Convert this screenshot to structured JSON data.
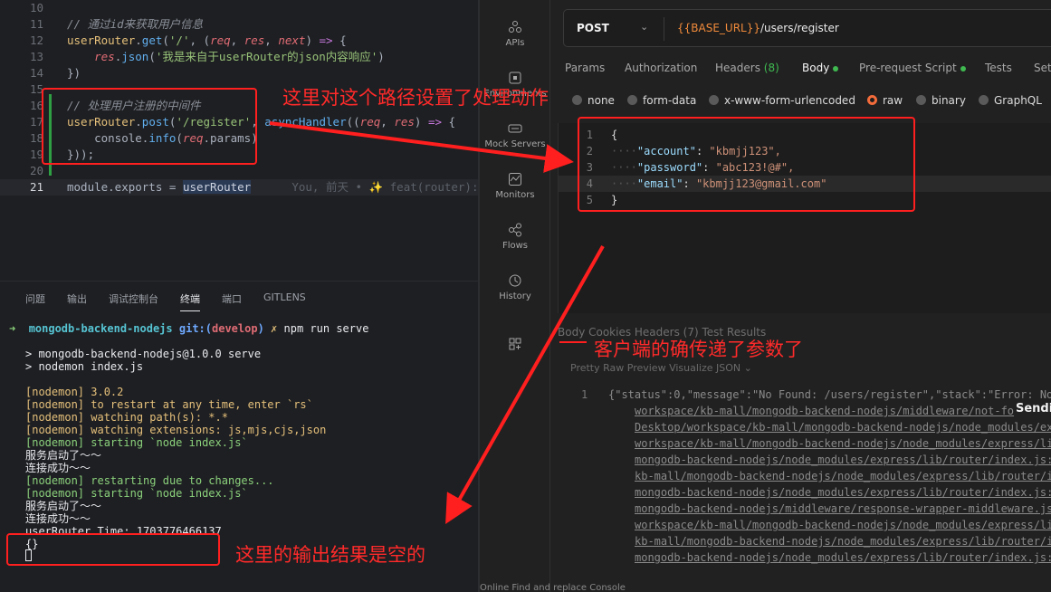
{
  "editor": {
    "lines": [
      {
        "n": "10",
        "parts": []
      },
      {
        "n": "11",
        "parts": [
          [
            "c-cmt",
            "// 通过id来获取用户信息"
          ]
        ]
      },
      {
        "n": "12",
        "parts": [
          [
            "c-id",
            "userRouter"
          ],
          [
            "c-pun",
            "."
          ],
          [
            "c-fn",
            "get"
          ],
          [
            "c-pun",
            "("
          ],
          [
            "c-str",
            "'/'"
          ],
          [
            "c-pun",
            ", ("
          ],
          [
            "c-par",
            "req"
          ],
          [
            "c-pun",
            ", "
          ],
          [
            "c-par",
            "res"
          ],
          [
            "c-pun",
            ", "
          ],
          [
            "c-par",
            "next"
          ],
          [
            "c-pun",
            ") "
          ],
          [
            "c-kw",
            "=>"
          ],
          [
            "c-pun",
            " {"
          ]
        ]
      },
      {
        "n": "13",
        "parts": [
          [
            "c-pun",
            "    "
          ],
          [
            "c-par",
            "res"
          ],
          [
            "c-pun",
            "."
          ],
          [
            "c-fn",
            "json"
          ],
          [
            "c-pun",
            "("
          ],
          [
            "c-str",
            "'我是来自于userRouter的json内容响应'"
          ],
          [
            "c-pun",
            ")"
          ]
        ]
      },
      {
        "n": "14",
        "parts": [
          [
            "c-pun",
            "})"
          ]
        ]
      },
      {
        "n": "15",
        "parts": []
      },
      {
        "n": "16",
        "parts": [
          [
            "c-cmt",
            "// 处理用户注册的中间件"
          ]
        ]
      },
      {
        "n": "17",
        "parts": [
          [
            "c-id",
            "userRouter"
          ],
          [
            "c-pun",
            "."
          ],
          [
            "c-fn",
            "post"
          ],
          [
            "c-pun",
            "("
          ],
          [
            "c-str",
            "'/register'"
          ],
          [
            "c-pun",
            ", "
          ],
          [
            "c-fn",
            "asyncHandler"
          ],
          [
            "c-pun",
            "(("
          ],
          [
            "c-par",
            "req"
          ],
          [
            "c-pun",
            ", "
          ],
          [
            "c-par",
            "res"
          ],
          [
            "c-pun",
            ") "
          ],
          [
            "c-kw",
            "=>"
          ],
          [
            "c-pun",
            " {"
          ]
        ]
      },
      {
        "n": "18",
        "parts": [
          [
            "c-pun",
            "    console."
          ],
          [
            "c-fn",
            "info"
          ],
          [
            "c-pun",
            "("
          ],
          [
            "c-par",
            "req"
          ],
          [
            "c-pun",
            ".params)"
          ]
        ]
      },
      {
        "n": "19",
        "parts": [
          [
            "c-pun",
            "}));"
          ]
        ]
      },
      {
        "n": "20",
        "parts": []
      },
      {
        "n": "21",
        "parts": [
          [
            "c-pun",
            "module.exports = "
          ],
          [
            "c-id-u",
            "userRouter"
          ],
          [
            "c-gho",
            "      You, 前天 • ✨ feat(router): 新"
          ]
        ]
      }
    ]
  },
  "terminal": {
    "tabs": [
      "问题",
      "输出",
      "调试控制台",
      "终端",
      "端口",
      "GITLENS"
    ],
    "active_tab": "终端",
    "prompt": {
      "arrow": "➜",
      "dir": "mongodb-backend-nodejs",
      "git": "git:(",
      "branch": "develop",
      "git_end": ")",
      "mark": "✗",
      "cmd": "npm run serve"
    },
    "lines": [
      [
        "t-white",
        "> mongodb-backend-nodejs@1.0.0 serve"
      ],
      [
        "t-white",
        "> nodemon index.js"
      ],
      [
        "",
        ""
      ],
      [
        "t-yellow",
        "[nodemon] 3.0.2"
      ],
      [
        "t-yellow",
        "[nodemon] to restart at any time, enter `rs`"
      ],
      [
        "t-yellow",
        "[nodemon] watching path(s): *.*"
      ],
      [
        "t-yellow",
        "[nodemon] watching extensions: js,mjs,cjs,json"
      ],
      [
        "t-green",
        "[nodemon] starting `node index.js`"
      ],
      [
        "t-white",
        "服务启动了～～"
      ],
      [
        "t-white",
        "连接成功～～"
      ],
      [
        "t-green",
        "[nodemon] restarting due to changes..."
      ],
      [
        "t-green",
        "[nodemon] starting `node index.js`"
      ],
      [
        "t-white",
        "服务启动了～～"
      ],
      [
        "t-white",
        "连接成功～～"
      ],
      [
        "t-white",
        "userRouter Time: 1703776466137"
      ],
      [
        "t-white",
        "{}"
      ]
    ]
  },
  "postman": {
    "sidebar": [
      {
        "label": "APIs",
        "icon": "apis-icon"
      },
      {
        "label": "Environments",
        "icon": "environments-icon"
      },
      {
        "label": "Mock Servers",
        "icon": "mock-servers-icon"
      },
      {
        "label": "Monitors",
        "icon": "monitors-icon"
      },
      {
        "label": "Flows",
        "icon": "flows-icon"
      },
      {
        "label": "History",
        "icon": "history-icon"
      }
    ],
    "method": "POST",
    "url_var": "{{BASE_URL}}",
    "url_path": "/users/register",
    "req_tabs": {
      "params": "Params",
      "authorization": "Authorization",
      "headers": "Headers",
      "headers_count": "(8)",
      "body": "Body",
      "prerequest": "Pre-request Script",
      "tests": "Tests",
      "settings": "Set"
    },
    "body_types": [
      "none",
      "form-data",
      "x-www-form-urlencoded",
      "raw",
      "binary",
      "GraphQL"
    ],
    "body_type_selected": "raw",
    "body_lines": [
      {
        "n": "1",
        "text": "{"
      },
      {
        "n": "2",
        "key": "\"account\"",
        "val": "\"kbmjj123\","
      },
      {
        "n": "3",
        "key": "\"password\"",
        "val": "\"abc123!@#\","
      },
      {
        "n": "4",
        "key": "\"email\"",
        "val": "\"kbmjj123@gmail.com\""
      },
      {
        "n": "5",
        "text": "}"
      }
    ],
    "resp_tabs": "Body    Cookies    Headers (7)    Test Results",
    "resp_tools": "Pretty       Raw        Preview       Visualize        JSON  ⌄",
    "resp_line_no": "1",
    "resp_lines": [
      "{\"status\":0,\"message\":\"No Found: /users/register\",\"stack\":\"Error: No",
      "workspace/kb-mall/mongodb-backend-nodejs/middleware/not-fo",
      "Desktop/workspace/kb-mall/mongodb-backend-nodejs/node_modules/ex",
      "workspace/kb-mall/mongodb-backend-nodejs/node_modules/express/li",
      "mongodb-backend-nodejs/node_modules/express/lib/router/index.js:",
      "kb-mall/mongodb-backend-nodejs/node_modules/express/lib/router/i",
      "mongodb-backend-nodejs/node_modules/express/lib/router/index.js:",
      "mongodb-backend-nodejs/middleware/response-wrapper-middleware.js",
      "workspace/kb-mall/mongodb-backend-nodejs/node_modules/express/li",
      "kb-mall/mongodb-backend-nodejs/node_modules/express/lib/router/i",
      "mongodb-backend-nodejs/node_modules/express/lib/router/index.js:"
    ],
    "sending": "Sendi",
    "statusbar": "Online    Find and replace    Console"
  },
  "annotations": {
    "route_note": "这里对这个路径设置了处理动作",
    "client_note": "客户端的确传递了参数了",
    "output_note": "这里的输出结果是空的",
    "color": "#ff1f1f"
  }
}
